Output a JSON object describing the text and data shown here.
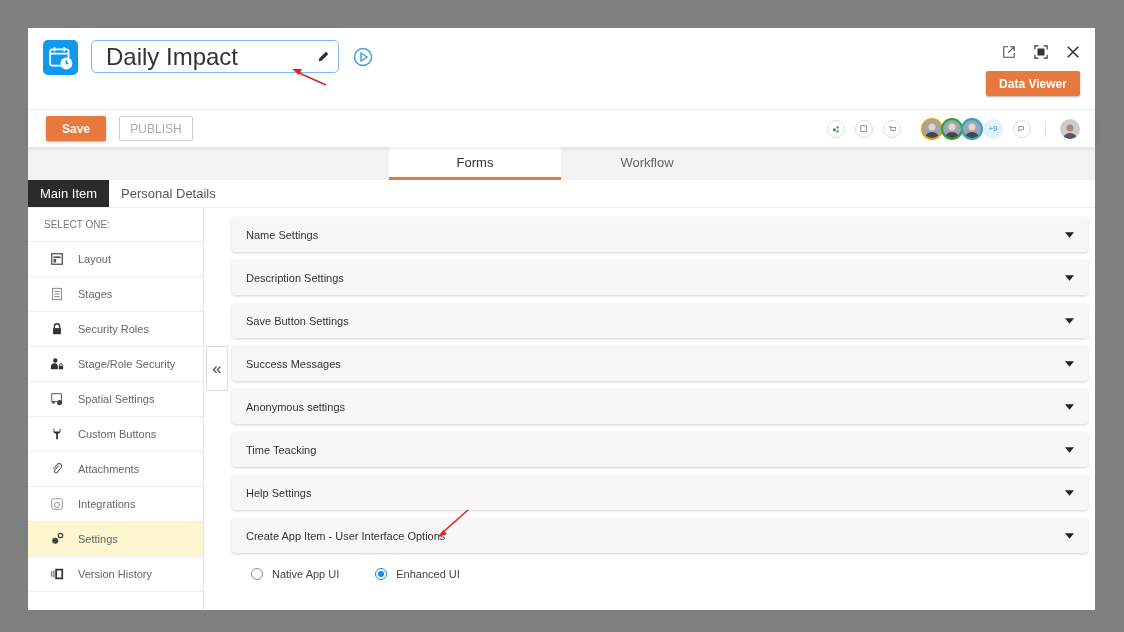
{
  "header": {
    "title": "Daily Impact",
    "data_viewer": "Data Viewer"
  },
  "toolbar": {
    "save": "Save",
    "publish": "PUBLISH",
    "avatars": [
      {
        "color": "#e0a020"
      },
      {
        "color": "#2e9e3a"
      },
      {
        "color": "#2aa6b8"
      }
    ],
    "more_count": "+9"
  },
  "tabs": [
    {
      "label": "Forms",
      "selected": true
    },
    {
      "label": "Workflow",
      "selected": false
    }
  ],
  "subtabs": [
    {
      "label": "Main Item",
      "selected": true
    },
    {
      "label": "Personal Details",
      "selected": false
    }
  ],
  "sidebar": {
    "heading": "SELECT ONE:",
    "collapse": "«",
    "items": [
      {
        "label": "Layout",
        "kind": "layout",
        "selected": false
      },
      {
        "label": "Stages",
        "kind": "stages",
        "selected": false
      },
      {
        "label": "Security Roles",
        "kind": "lock",
        "selected": false
      },
      {
        "label": "Stage/Role Security",
        "kind": "user-lock",
        "selected": false
      },
      {
        "label": "Spatial Settings",
        "kind": "spatial",
        "selected": false
      },
      {
        "label": "Custom Buttons",
        "kind": "wrench",
        "selected": false
      },
      {
        "label": "Attachments",
        "kind": "clip",
        "selected": false
      },
      {
        "label": "Integrations",
        "kind": "integrations",
        "selected": false
      },
      {
        "label": "Settings",
        "kind": "gears",
        "selected": true
      },
      {
        "label": "Version History",
        "kind": "history",
        "selected": false
      }
    ]
  },
  "sections": [
    {
      "title": "Name Settings"
    },
    {
      "title": "Description Settings"
    },
    {
      "title": "Save Button Settings"
    },
    {
      "title": "Success Messages"
    },
    {
      "title": "Anonymous settings"
    },
    {
      "title": "Time Teacking"
    },
    {
      "title": "Help Settings"
    },
    {
      "title": "Create App Item - User Interface Options",
      "options": [
        {
          "label": "Native App UI",
          "selected": false
        },
        {
          "label": "Enhanced UI",
          "selected": true
        }
      ]
    }
  ]
}
